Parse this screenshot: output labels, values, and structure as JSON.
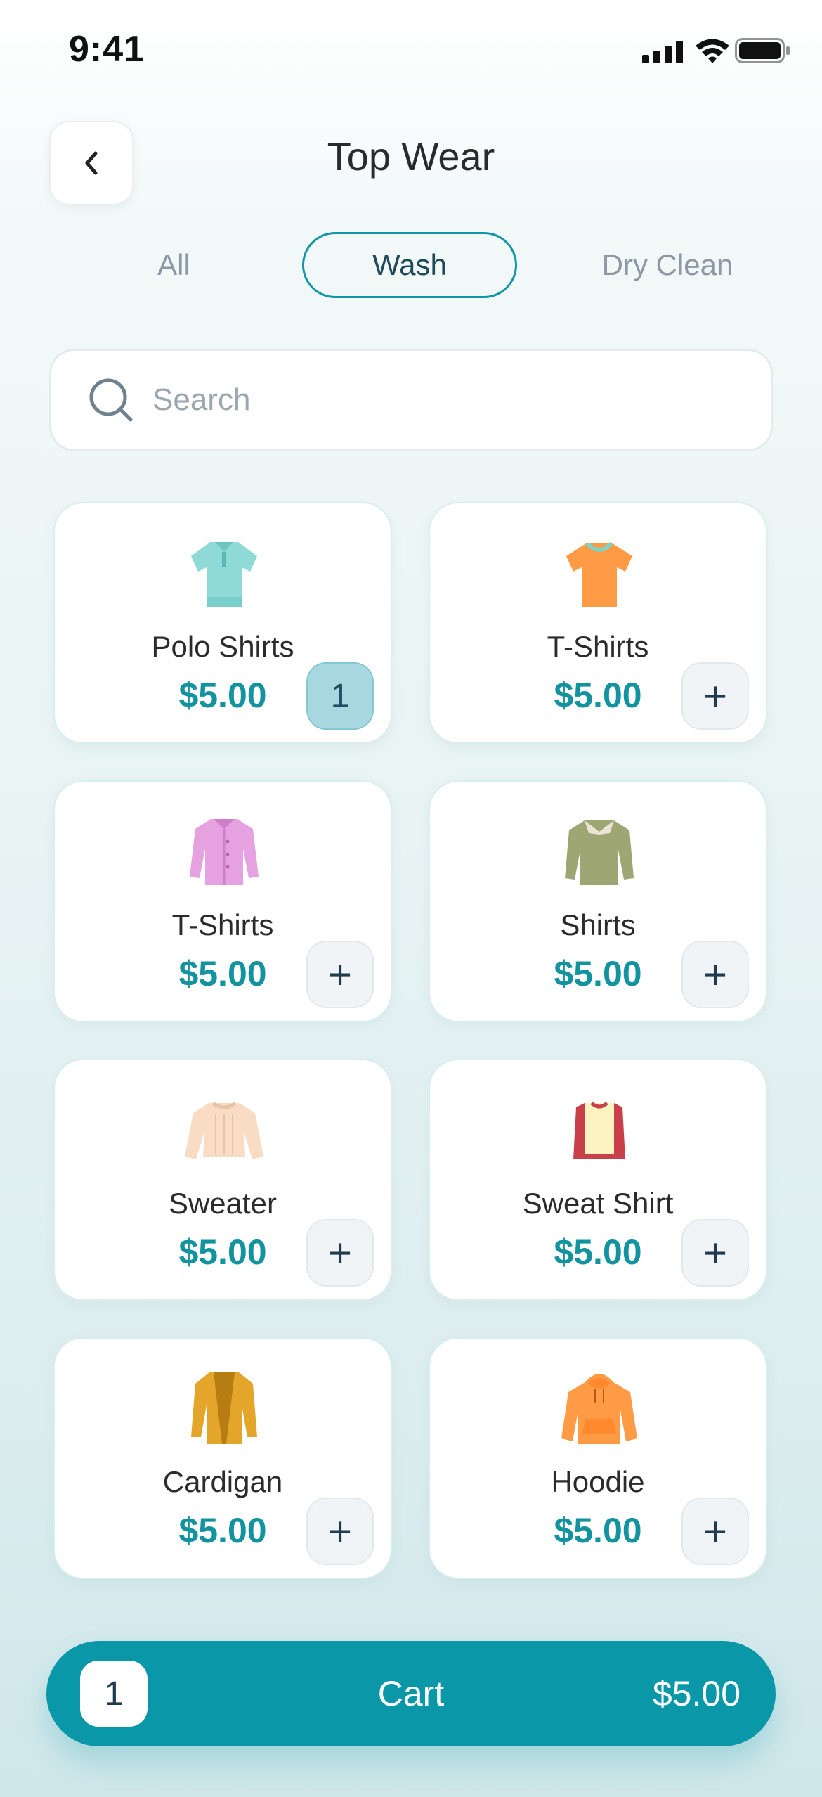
{
  "status_bar": {
    "time": "9:41"
  },
  "header": {
    "title": "Top Wear"
  },
  "tabs": [
    {
      "label": "All",
      "active": false
    },
    {
      "label": "Wash",
      "active": true
    },
    {
      "label": "Dry Clean",
      "active": false
    }
  ],
  "search": {
    "placeholder": "Search",
    "value": ""
  },
  "items": [
    {
      "name": "Polo Shirts",
      "price": "$5.00",
      "qty": "1",
      "icon": "polo-shirt-icon"
    },
    {
      "name": "T-Shirts",
      "price": "$5.00",
      "qty": "",
      "icon": "t-shirt-icon"
    },
    {
      "name": "T-Shirts",
      "price": "$5.00",
      "qty": "",
      "icon": "pink-shirt-icon"
    },
    {
      "name": "Shirts",
      "price": "$5.00",
      "qty": "",
      "icon": "collared-shirt-icon"
    },
    {
      "name": "Sweater",
      "price": "$5.00",
      "qty": "",
      "icon": "sweater-icon"
    },
    {
      "name": "Sweat Shirt",
      "price": "$5.00",
      "qty": "",
      "icon": "sweat-shirt-icon"
    },
    {
      "name": "Cardigan",
      "price": "$5.00",
      "qty": "",
      "icon": "cardigan-icon"
    },
    {
      "name": "Hoodie",
      "price": "$5.00",
      "qty": "",
      "icon": "hoodie-icon"
    }
  ],
  "add_symbol": "+",
  "cart": {
    "count": "1",
    "label": "Cart",
    "total": "$5.00"
  },
  "colors": {
    "accent": "#0a97a8",
    "price": "#13939f",
    "qty_badge": "#a8d8df"
  }
}
